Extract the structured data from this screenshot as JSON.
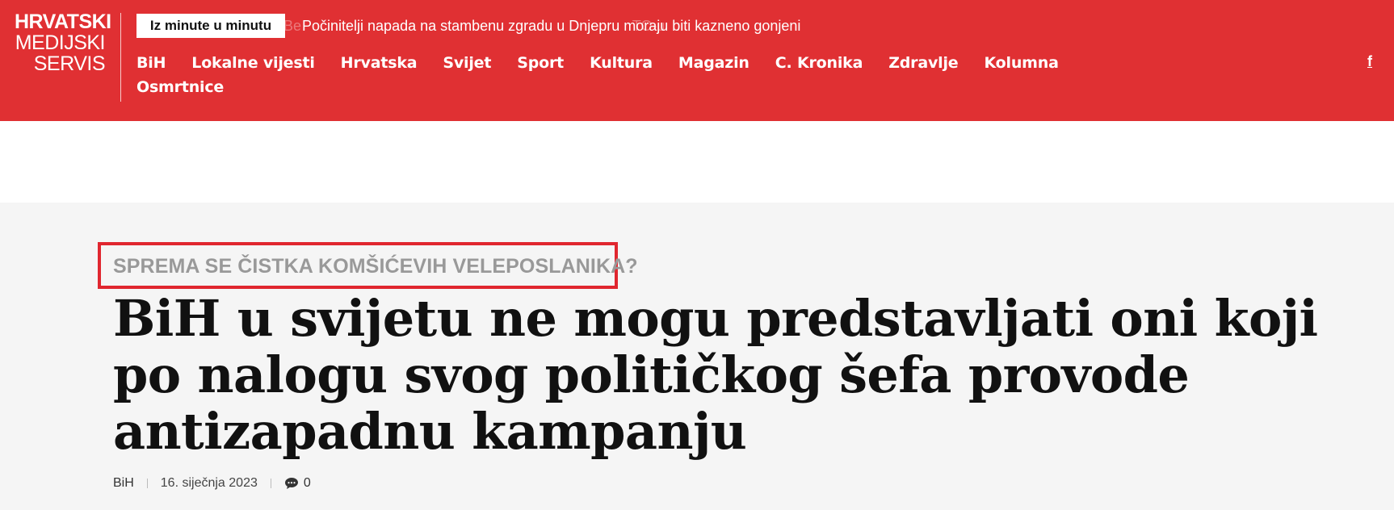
{
  "logo": {
    "line1": "HRVATSKI",
    "line2": "MEDIJSKI",
    "line3": "SERVIS"
  },
  "ticker": {
    "label": "Iz minute u minutu",
    "faded_text": "Be                                                                                  TO-u",
    "current": "Počinitelji napada na stambenu zgradu u Dnjepru moraju biti kazneno gonjeni"
  },
  "nav": {
    "items": [
      "BiH",
      "Lokalne vijesti",
      "Hrvatska",
      "Svijet",
      "Sport",
      "Kultura",
      "Magazin",
      "C. Kronika",
      "Zdravlje",
      "Kolumna",
      "Osmrtnice"
    ]
  },
  "social": {
    "facebook": "f"
  },
  "article": {
    "kicker": "SPREMA SE ČISTKA KOMŠIĆEVIH VELEPOSLANIKA?",
    "headline": "BiH u svijetu ne mogu predstavljati oni koji po nalogu svog političkog šefa provode antizapadnu kampanju",
    "category": "BiH",
    "date": "16. siječnja 2023",
    "comments": "0"
  },
  "colors": {
    "brand_red": "#e03033",
    "highlight_border": "#e0262f"
  },
  "icons": {
    "comment": "comment-bubble-icon",
    "facebook": "facebook-icon"
  }
}
